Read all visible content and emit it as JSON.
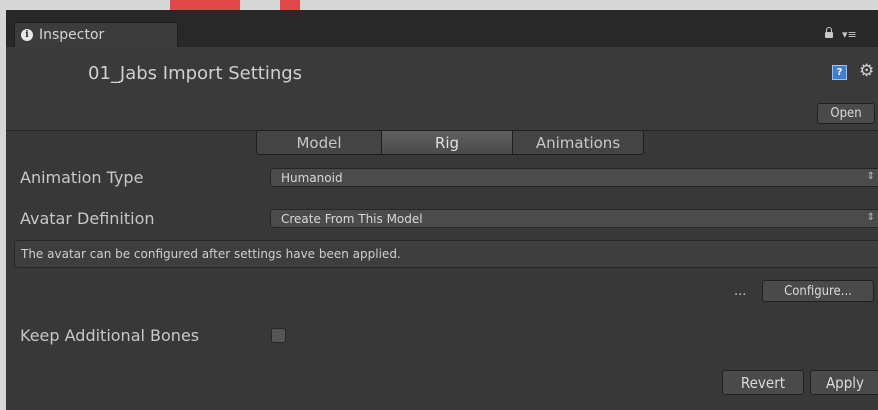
{
  "window": {
    "tab_label": "Inspector",
    "title": "01_Jabs Import Settings",
    "open_label": "Open"
  },
  "toolbar": {
    "tabs": [
      "Model",
      "Rig",
      "Animations"
    ],
    "selected": "Rig"
  },
  "animation_type": {
    "label": "Animation Type",
    "value": "Humanoid"
  },
  "avatar_definition": {
    "label": "Avatar Definition",
    "value": "Create From This Model"
  },
  "info_message": "The avatar can be configured after settings have been applied.",
  "configure": {
    "ellipsis": "...",
    "button_label": "Configure..."
  },
  "keep_additional_bones": {
    "label": "Keep Additional Bones",
    "checked": false
  },
  "footer": {
    "revert_label": "Revert",
    "apply_label": "Apply"
  },
  "icons": {
    "tab": "info-icon",
    "lock": "lock-icon",
    "menu": "menu-icon",
    "help": "help-icon",
    "settings": "gear-icon",
    "dropdown": "dropdown-arrow-icon"
  }
}
